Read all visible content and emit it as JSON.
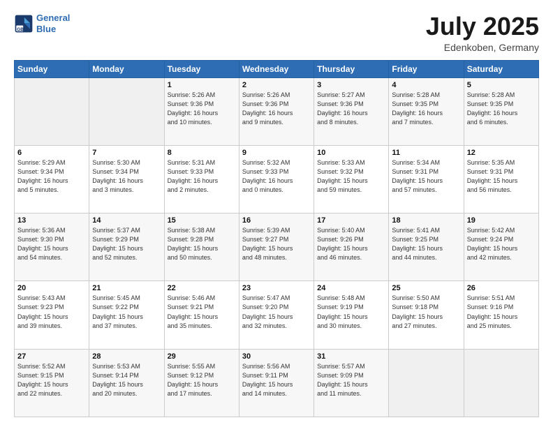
{
  "logo": {
    "line1": "General",
    "line2": "Blue"
  },
  "header": {
    "title": "July 2025",
    "subtitle": "Edenkoben, Germany"
  },
  "weekdays": [
    "Sunday",
    "Monday",
    "Tuesday",
    "Wednesday",
    "Thursday",
    "Friday",
    "Saturday"
  ],
  "weeks": [
    [
      {
        "day": "",
        "info": ""
      },
      {
        "day": "",
        "info": ""
      },
      {
        "day": "1",
        "info": "Sunrise: 5:26 AM\nSunset: 9:36 PM\nDaylight: 16 hours\nand 10 minutes."
      },
      {
        "day": "2",
        "info": "Sunrise: 5:26 AM\nSunset: 9:36 PM\nDaylight: 16 hours\nand 9 minutes."
      },
      {
        "day": "3",
        "info": "Sunrise: 5:27 AM\nSunset: 9:36 PM\nDaylight: 16 hours\nand 8 minutes."
      },
      {
        "day": "4",
        "info": "Sunrise: 5:28 AM\nSunset: 9:35 PM\nDaylight: 16 hours\nand 7 minutes."
      },
      {
        "day": "5",
        "info": "Sunrise: 5:28 AM\nSunset: 9:35 PM\nDaylight: 16 hours\nand 6 minutes."
      }
    ],
    [
      {
        "day": "6",
        "info": "Sunrise: 5:29 AM\nSunset: 9:34 PM\nDaylight: 16 hours\nand 5 minutes."
      },
      {
        "day": "7",
        "info": "Sunrise: 5:30 AM\nSunset: 9:34 PM\nDaylight: 16 hours\nand 3 minutes."
      },
      {
        "day": "8",
        "info": "Sunrise: 5:31 AM\nSunset: 9:33 PM\nDaylight: 16 hours\nand 2 minutes."
      },
      {
        "day": "9",
        "info": "Sunrise: 5:32 AM\nSunset: 9:33 PM\nDaylight: 16 hours\nand 0 minutes."
      },
      {
        "day": "10",
        "info": "Sunrise: 5:33 AM\nSunset: 9:32 PM\nDaylight: 15 hours\nand 59 minutes."
      },
      {
        "day": "11",
        "info": "Sunrise: 5:34 AM\nSunset: 9:31 PM\nDaylight: 15 hours\nand 57 minutes."
      },
      {
        "day": "12",
        "info": "Sunrise: 5:35 AM\nSunset: 9:31 PM\nDaylight: 15 hours\nand 56 minutes."
      }
    ],
    [
      {
        "day": "13",
        "info": "Sunrise: 5:36 AM\nSunset: 9:30 PM\nDaylight: 15 hours\nand 54 minutes."
      },
      {
        "day": "14",
        "info": "Sunrise: 5:37 AM\nSunset: 9:29 PM\nDaylight: 15 hours\nand 52 minutes."
      },
      {
        "day": "15",
        "info": "Sunrise: 5:38 AM\nSunset: 9:28 PM\nDaylight: 15 hours\nand 50 minutes."
      },
      {
        "day": "16",
        "info": "Sunrise: 5:39 AM\nSunset: 9:27 PM\nDaylight: 15 hours\nand 48 minutes."
      },
      {
        "day": "17",
        "info": "Sunrise: 5:40 AM\nSunset: 9:26 PM\nDaylight: 15 hours\nand 46 minutes."
      },
      {
        "day": "18",
        "info": "Sunrise: 5:41 AM\nSunset: 9:25 PM\nDaylight: 15 hours\nand 44 minutes."
      },
      {
        "day": "19",
        "info": "Sunrise: 5:42 AM\nSunset: 9:24 PM\nDaylight: 15 hours\nand 42 minutes."
      }
    ],
    [
      {
        "day": "20",
        "info": "Sunrise: 5:43 AM\nSunset: 9:23 PM\nDaylight: 15 hours\nand 39 minutes."
      },
      {
        "day": "21",
        "info": "Sunrise: 5:45 AM\nSunset: 9:22 PM\nDaylight: 15 hours\nand 37 minutes."
      },
      {
        "day": "22",
        "info": "Sunrise: 5:46 AM\nSunset: 9:21 PM\nDaylight: 15 hours\nand 35 minutes."
      },
      {
        "day": "23",
        "info": "Sunrise: 5:47 AM\nSunset: 9:20 PM\nDaylight: 15 hours\nand 32 minutes."
      },
      {
        "day": "24",
        "info": "Sunrise: 5:48 AM\nSunset: 9:19 PM\nDaylight: 15 hours\nand 30 minutes."
      },
      {
        "day": "25",
        "info": "Sunrise: 5:50 AM\nSunset: 9:18 PM\nDaylight: 15 hours\nand 27 minutes."
      },
      {
        "day": "26",
        "info": "Sunrise: 5:51 AM\nSunset: 9:16 PM\nDaylight: 15 hours\nand 25 minutes."
      }
    ],
    [
      {
        "day": "27",
        "info": "Sunrise: 5:52 AM\nSunset: 9:15 PM\nDaylight: 15 hours\nand 22 minutes."
      },
      {
        "day": "28",
        "info": "Sunrise: 5:53 AM\nSunset: 9:14 PM\nDaylight: 15 hours\nand 20 minutes."
      },
      {
        "day": "29",
        "info": "Sunrise: 5:55 AM\nSunset: 9:12 PM\nDaylight: 15 hours\nand 17 minutes."
      },
      {
        "day": "30",
        "info": "Sunrise: 5:56 AM\nSunset: 9:11 PM\nDaylight: 15 hours\nand 14 minutes."
      },
      {
        "day": "31",
        "info": "Sunrise: 5:57 AM\nSunset: 9:09 PM\nDaylight: 15 hours\nand 11 minutes."
      },
      {
        "day": "",
        "info": ""
      },
      {
        "day": "",
        "info": ""
      }
    ]
  ]
}
